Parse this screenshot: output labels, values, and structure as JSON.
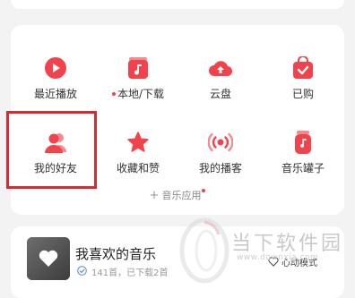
{
  "grid": {
    "items": [
      {
        "label": "最近播放",
        "icon": "play-icon"
      },
      {
        "label": "本地/下载",
        "icon": "music-note-icon",
        "has_dot": true
      },
      {
        "label": "云盘",
        "icon": "cloud-upload-icon"
      },
      {
        "label": "已购",
        "icon": "purchased-bag-icon"
      },
      {
        "label": "我的好友",
        "icon": "friends-icon",
        "highlighted": true
      },
      {
        "label": "收藏和赞",
        "icon": "star-icon"
      },
      {
        "label": "我的播客",
        "icon": "podcast-icon"
      },
      {
        "label": "音乐罐子",
        "icon": "music-jar-icon"
      }
    ],
    "more_label": "音乐应用"
  },
  "playlist": {
    "title": "我喜欢的音乐",
    "subtitle": "141首，已下载2首",
    "mode_label": "心动模式"
  },
  "watermark": {
    "text": "当下软件园",
    "url": "www.downxia.com"
  },
  "colors": {
    "accent": "#f2424b",
    "highlight_border": "#d62b30",
    "background": "#f3f3f3"
  }
}
